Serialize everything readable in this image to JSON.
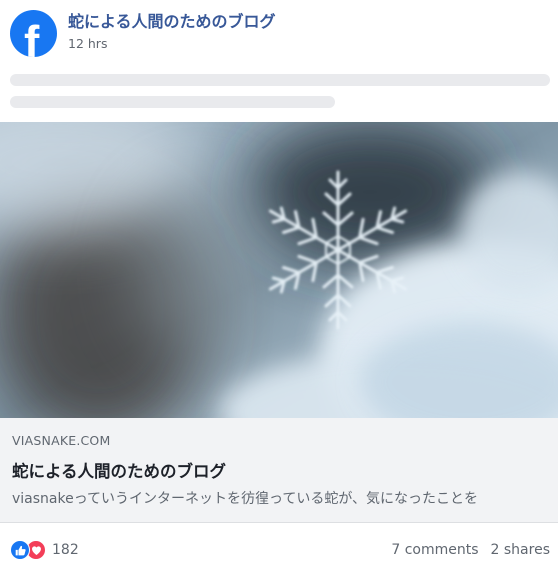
{
  "post": {
    "page_name": "蛇による人間のためのブログ",
    "timestamp": "12 hrs"
  },
  "link_preview": {
    "domain": "VIASNAKE.COM",
    "title": "蛇による人間のためのブログ",
    "description": "viasnakeっていうインターネットを彷徨っている蛇が、気になったことを"
  },
  "engagement": {
    "reaction_count": "182",
    "comments": "7 comments",
    "shares": "2 shares",
    "reaction_icons": [
      "like-icon",
      "love-icon"
    ]
  },
  "colors": {
    "brand": "#1877f2",
    "page_name": "#385898",
    "love": "#f33e58",
    "link_bg": "#f2f3f5"
  }
}
